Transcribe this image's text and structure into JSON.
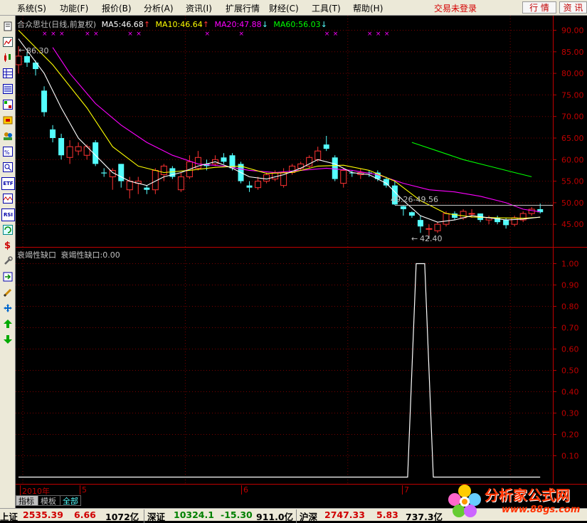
{
  "menubar": {
    "items": [
      "系统(S)",
      "功能(F)",
      "报价(B)",
      "分析(A)",
      "资讯(I)",
      "扩展行情",
      "财经(C)",
      "工具(T)",
      "帮助(H)"
    ],
    "login_status": "交易未登录",
    "btn_quote": "行 情",
    "btn_info": "资 讯"
  },
  "toolbar": {
    "icons": [
      "doc-icon",
      "line-chart-icon",
      "candle-chart-icon",
      "table-icon",
      "list-icon",
      "grid-icon",
      "tools-icon",
      "users-icon",
      "tech-icon",
      "zoom-icon",
      "etf-icon",
      "wave-icon",
      "rsi-icon",
      "refresh-icon",
      "dollar-icon",
      "wrench-icon",
      "import-icon",
      "pencil-icon",
      "move-icon",
      "arrow-up-icon",
      "arrow-down-icon"
    ],
    "labels": {
      "etf": "ETF",
      "rsi": "RSI",
      "dollar": "$"
    }
  },
  "price_legend": {
    "stock": "合众思壮(日线,前复权)",
    "ma5": "MA5:46.68",
    "ma10": "MA10:46.64",
    "ma20": "MA20:47.88",
    "ma60": "MA60:56.03",
    "arrow_up": "↑",
    "arrow_down": "↓",
    "colors": {
      "ma5": "#ffffff",
      "ma10": "#ffff00",
      "ma20": "#ff00ff",
      "ma60": "#00ff00",
      "stock": "#c0c0c0"
    }
  },
  "annotations": {
    "high": "86.30",
    "low": "42.40",
    "gap": "49.26-49.56",
    "high_arrow": "←",
    "low_arrow": "←"
  },
  "indicator_legend": {
    "name": "衰竭性缺口",
    "value": "衰竭性缺口:0.00"
  },
  "price_axis_labels": [
    "90.00",
    "85.00",
    "80.00",
    "75.00",
    "70.00",
    "65.00",
    "60.00",
    "55.00",
    "50.00",
    "45.00"
  ],
  "indicator_axis_labels": [
    "1.00",
    "0.90",
    "0.80",
    "0.70",
    "0.60",
    "0.50",
    "0.40",
    "0.30",
    "0.20",
    "0.10"
  ],
  "x_axis": {
    "year_label": "2010年",
    "months": [
      "5",
      "6",
      "7"
    ]
  },
  "tabs": [
    "指标",
    "模板",
    "全部"
  ],
  "statusbar": {
    "sh_label": "上证",
    "sh_value": "2535.39",
    "sh_change": "6.66",
    "sh_amount": "1072亿",
    "sz_label": "深证",
    "sz_value": "10324.1",
    "sz_change": "-15.30",
    "sz_amount": "911.0亿",
    "hs_label": "沪深",
    "hs_value": "2747.33",
    "hs_change": "5.83",
    "hs_amount": "737.3亿"
  },
  "logo": {
    "title": "分析家公式网",
    "url": "www.88gs.com"
  },
  "colors": {
    "up": "#ff3232",
    "down": "#54ffff",
    "axis": "#c00000",
    "grid": "#7a0000",
    "bg": "#000000"
  },
  "chart_data": [
    {
      "type": "candlestick",
      "title": "合众思壮(日线,前复权)",
      "ylim": [
        40,
        92
      ],
      "y_ticks": [
        45,
        50,
        55,
        60,
        65,
        70,
        75,
        80,
        85,
        90
      ],
      "x_months": [
        "5",
        "6",
        "7"
      ],
      "candles": [
        {
          "o": 82,
          "c": 84,
          "h": 86.3,
          "l": 80
        },
        {
          "o": 84,
          "c": 82.5,
          "h": 85,
          "l": 81.5
        },
        {
          "o": 82.5,
          "c": 81,
          "h": 83,
          "l": 79.5
        },
        {
          "o": 76,
          "c": 71,
          "h": 77,
          "l": 70
        },
        {
          "o": 67,
          "c": 65,
          "h": 68,
          "l": 64
        },
        {
          "o": 65,
          "c": 61,
          "h": 66,
          "l": 60
        },
        {
          "o": 60.5,
          "c": 63,
          "h": 64.5,
          "l": 59
        },
        {
          "o": 62,
          "c": 63,
          "h": 64,
          "l": 61
        },
        {
          "o": 61,
          "c": 63,
          "h": 63.5,
          "l": 60
        },
        {
          "o": 64,
          "c": 59,
          "h": 64.5,
          "l": 58.5
        },
        {
          "o": 57,
          "c": 56.8,
          "h": 58,
          "l": 56
        },
        {
          "o": 56,
          "c": 57.5,
          "h": 58,
          "l": 53
        },
        {
          "o": 59,
          "c": 55,
          "h": 59,
          "l": 53.5
        },
        {
          "o": 53,
          "c": 55,
          "h": 56,
          "l": 51
        },
        {
          "o": 54.5,
          "c": 55,
          "h": 56,
          "l": 52
        },
        {
          "o": 53.5,
          "c": 53,
          "h": 54,
          "l": 52
        },
        {
          "o": 53,
          "c": 57.5,
          "h": 58,
          "l": 52
        },
        {
          "o": 56.5,
          "c": 58.5,
          "h": 59,
          "l": 55
        },
        {
          "o": 58,
          "c": 56,
          "h": 58.5,
          "l": 55.5
        },
        {
          "o": 53,
          "c": 56,
          "h": 57,
          "l": 52.5
        },
        {
          "o": 56,
          "c": 59.5,
          "h": 61,
          "l": 55.5
        },
        {
          "o": 58,
          "c": 60.5,
          "h": 62,
          "l": 57.5
        },
        {
          "o": 59,
          "c": 58.5,
          "h": 60,
          "l": 57.5
        },
        {
          "o": 59,
          "c": 60,
          "h": 61,
          "l": 58.5
        },
        {
          "o": 60.5,
          "c": 59.5,
          "h": 61.5,
          "l": 59
        },
        {
          "o": 61,
          "c": 58,
          "h": 61.5,
          "l": 57.5
        },
        {
          "o": 59,
          "c": 55,
          "h": 59.5,
          "l": 54.5
        },
        {
          "o": 54,
          "c": 53.5,
          "h": 55,
          "l": 52.5
        },
        {
          "o": 53.5,
          "c": 55,
          "h": 56,
          "l": 53
        },
        {
          "o": 55,
          "c": 56.5,
          "h": 57,
          "l": 54.5
        },
        {
          "o": 55.5,
          "c": 57,
          "h": 57.5,
          "l": 55
        },
        {
          "o": 54,
          "c": 57,
          "h": 58,
          "l": 53.5
        },
        {
          "o": 57,
          "c": 58.5,
          "h": 59,
          "l": 56.5
        },
        {
          "o": 58,
          "c": 59,
          "h": 59.5,
          "l": 57.5
        },
        {
          "o": 58.5,
          "c": 60.5,
          "h": 61,
          "l": 58
        },
        {
          "o": 60,
          "c": 62,
          "h": 63,
          "l": 59.5
        },
        {
          "o": 63.5,
          "c": 62.5,
          "h": 65.5,
          "l": 62
        },
        {
          "o": 60.5,
          "c": 55.5,
          "h": 61,
          "l": 55
        },
        {
          "o": 54.5,
          "c": 57.5,
          "h": 58,
          "l": 53.5
        },
        {
          "o": 57,
          "c": 56.8,
          "h": 57.5,
          "l": 56
        },
        {
          "o": 56.5,
          "c": 57,
          "h": 58,
          "l": 55.5
        },
        {
          "o": 57,
          "c": 56.8,
          "h": 57.5,
          "l": 56
        },
        {
          "o": 57,
          "c": 55.5,
          "h": 57.5,
          "l": 55
        },
        {
          "o": 55.5,
          "c": 54,
          "h": 56,
          "l": 53.5
        },
        {
          "o": 54,
          "c": 49.6,
          "h": 55,
          "l": 49.5
        },
        {
          "o": 49.2,
          "c": 48.5,
          "h": 49.3,
          "l": 47
        },
        {
          "o": 47.8,
          "c": 47,
          "h": 48,
          "l": 46.5
        },
        {
          "o": 46,
          "c": 44.5,
          "h": 47,
          "l": 43
        },
        {
          "o": 44,
          "c": 44,
          "h": 45,
          "l": 42.4
        },
        {
          "o": 43.5,
          "c": 45,
          "h": 45.5,
          "l": 43
        },
        {
          "o": 45,
          "c": 47.5,
          "h": 48,
          "l": 44.5
        },
        {
          "o": 47.5,
          "c": 46.5,
          "h": 48,
          "l": 46
        },
        {
          "o": 46.5,
          "c": 48,
          "h": 48.5,
          "l": 46
        },
        {
          "o": 47.5,
          "c": 47.5,
          "h": 48.5,
          "l": 46.5
        },
        {
          "o": 47.5,
          "c": 46,
          "h": 47.5,
          "l": 45.5
        },
        {
          "o": 46,
          "c": 46.5,
          "h": 47,
          "l": 45
        },
        {
          "o": 46.5,
          "c": 45.5,
          "h": 47,
          "l": 45
        },
        {
          "o": 46,
          "c": 44.8,
          "h": 46.5,
          "l": 44
        },
        {
          "o": 45,
          "c": 46.5,
          "h": 47,
          "l": 44.5
        },
        {
          "o": 46,
          "c": 47.5,
          "h": 48,
          "l": 45.5
        },
        {
          "o": 47.5,
          "c": 48.5,
          "h": 49,
          "l": 47
        },
        {
          "o": 48.5,
          "c": 47.8,
          "h": 49.8,
          "l": 47.5
        }
      ],
      "ma5": [
        [
          0,
          88
        ],
        [
          3,
          80
        ],
        [
          5,
          72
        ],
        [
          7,
          65
        ],
        [
          9,
          61
        ],
        [
          11,
          57
        ],
        [
          13,
          55
        ],
        [
          15,
          54
        ],
        [
          17,
          56
        ],
        [
          19,
          57
        ],
        [
          21,
          58.5
        ],
        [
          23,
          59.5
        ],
        [
          25,
          58
        ],
        [
          27,
          56
        ],
        [
          29,
          55.5
        ],
        [
          31,
          56.5
        ],
        [
          33,
          58
        ],
        [
          35,
          60
        ],
        [
          37,
          59
        ],
        [
          39,
          57
        ],
        [
          41,
          56.5
        ],
        [
          43,
          54.5
        ],
        [
          45,
          50.5
        ],
        [
          47,
          47
        ],
        [
          49,
          45.5
        ],
        [
          51,
          46
        ],
        [
          53,
          47
        ],
        [
          55,
          46.5
        ],
        [
          57,
          46
        ],
        [
          59,
          46.2
        ],
        [
          61,
          46.68
        ]
      ],
      "ma10": [
        [
          0,
          90
        ],
        [
          4,
          82
        ],
        [
          8,
          72
        ],
        [
          11,
          63
        ],
        [
          14,
          58.5
        ],
        [
          17,
          57
        ],
        [
          20,
          57.5
        ],
        [
          23,
          58.2
        ],
        [
          26,
          58.5
        ],
        [
          29,
          56.8
        ],
        [
          32,
          57
        ],
        [
          35,
          58.5
        ],
        [
          38,
          58.7
        ],
        [
          41,
          57.5
        ],
        [
          44,
          55
        ],
        [
          47,
          50.5
        ],
        [
          50,
          47.5
        ],
        [
          53,
          46.7
        ],
        [
          56,
          46.5
        ],
        [
          59,
          46.4
        ],
        [
          61,
          46.64
        ]
      ],
      "ma20": [
        [
          4,
          86
        ],
        [
          6,
          80
        ],
        [
          9,
          73
        ],
        [
          12,
          68
        ],
        [
          15,
          64
        ],
        [
          18,
          61
        ],
        [
          21,
          59
        ],
        [
          24,
          58.5
        ],
        [
          27,
          57.5
        ],
        [
          30,
          57
        ],
        [
          33,
          57.5
        ],
        [
          36,
          58
        ],
        [
          39,
          57.5
        ],
        [
          42,
          56.5
        ],
        [
          45,
          54.5
        ],
        [
          48,
          53
        ],
        [
          51,
          52.5
        ],
        [
          54,
          51.5
        ],
        [
          57,
          50
        ],
        [
          59,
          48.5
        ],
        [
          61,
          47.88
        ]
      ],
      "ma60": [
        [
          46,
          64
        ],
        [
          49,
          62
        ],
        [
          52,
          60
        ],
        [
          55,
          58.5
        ],
        [
          58,
          57
        ],
        [
          60,
          56.03
        ]
      ],
      "ma_last": {
        "ma5": 46.68,
        "ma10": 46.64,
        "ma20": 47.88,
        "ma60": 56.03
      },
      "high_marker": {
        "index": 0,
        "value": 86.3
      },
      "low_marker": {
        "index": 48,
        "value": 42.4
      },
      "gap_level": 49.4
    },
    {
      "type": "line",
      "title": "衰竭性缺口",
      "ylim": [
        0,
        1.0
      ],
      "y_ticks": [
        0.1,
        0.2,
        0.3,
        0.4,
        0.5,
        0.6,
        0.7,
        0.8,
        0.9,
        1.0
      ],
      "series": [
        {
          "name": "衰竭性缺口",
          "points": [
            [
              0,
              0
            ],
            [
              45.5,
              0
            ],
            [
              46.5,
              1
            ],
            [
              47.5,
              1
            ],
            [
              48.5,
              0
            ],
            [
              61,
              0
            ]
          ]
        }
      ],
      "last_value": 0.0
    }
  ]
}
